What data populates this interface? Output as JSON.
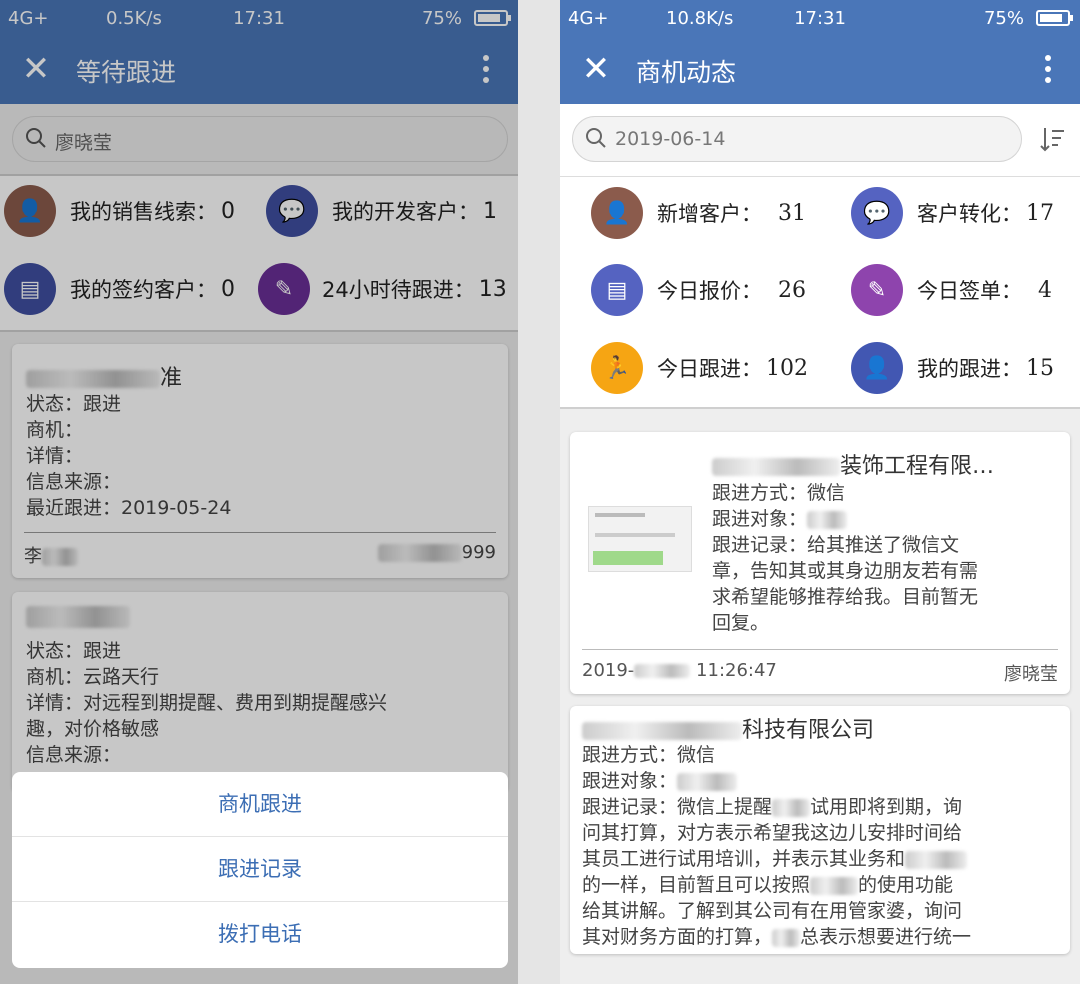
{
  "status_left": {
    "network": "4G+",
    "speed": "0.5K/s",
    "time": "17:31",
    "battery": "75%"
  },
  "status_right": {
    "network": "4G+",
    "speed": "10.8K/s",
    "time": "17:31",
    "battery": "75%"
  },
  "left": {
    "title": "等待跟进",
    "search_value": "廖晓莹",
    "stats": [
      {
        "label": "我的销售线索：",
        "value": "0",
        "icon": "user-icon",
        "color": "#8b5b4c"
      },
      {
        "label": "我的开发客户：",
        "value": "1",
        "icon": "chat-icon",
        "color": "#3f4fa0"
      },
      {
        "label": "我的签约客户：",
        "value": "0",
        "icon": "document-icon",
        "color": "#3f4fa0"
      },
      {
        "label": "24小时待跟进：",
        "value": "13",
        "icon": "edit-icon",
        "color": "#6a2f96"
      }
    ],
    "cards": [
      {
        "title_visible": "准",
        "lines": [
          "状态：跟进",
          "商机：",
          "详情：",
          "信息来源：",
          "最近跟进：2019-05-24"
        ],
        "footer_left": "李",
        "footer_right": "999"
      },
      {
        "lines": [
          "状态：跟进",
          "商机：云路天行",
          "详情：对远程到期提醒、费用到期提醒感兴",
          "趣，对价格敏感",
          "信息来源："
        ]
      }
    ],
    "sheet": [
      "商机跟进",
      "跟进记录",
      "拨打电话"
    ]
  },
  "right": {
    "title": "商机动态",
    "search_value": "2019-06-14",
    "stats": [
      {
        "label": "新增客户：",
        "value": "31",
        "icon": "user-icon",
        "color": "#8b5b4c"
      },
      {
        "label": "客户转化：",
        "value": "17",
        "icon": "chat-icon",
        "color": "#5563c1"
      },
      {
        "label": "今日报价：",
        "value": "26",
        "icon": "document-icon",
        "color": "#5563c1"
      },
      {
        "label": "今日签单：",
        "value": "4",
        "icon": "edit-icon",
        "color": "#8e44ad"
      },
      {
        "label": "今日跟进：",
        "value": "102",
        "icon": "runner-icon",
        "color": "#f6a513"
      },
      {
        "label": "我的跟进：",
        "value": "15",
        "icon": "person-icon",
        "color": "#4257b2"
      }
    ],
    "cards": [
      {
        "title": "装饰工程有限…",
        "method": "跟进方式：微信",
        "target": "跟进对象：",
        "record": [
          "跟进记录：给其推送了微信文",
          "章，告知其或其身边朋友若有需",
          "求希望能够推荐给我。目前暂无",
          "回复。"
        ],
        "date": "2019-",
        "time": "11:26:47",
        "author": "廖晓莹"
      },
      {
        "title": "科技有限公司",
        "method": "跟进方式：微信",
        "target": "跟进对象：",
        "record": [
          "跟进记录：微信上提醒",
          "试用即将到期，询",
          "问其打算，对方表示希望我这边儿安排时间给",
          "其员工进行试用培训，并表示其业务和",
          "的一样，目前暂且可以按照",
          "的使用功能",
          "给其讲解。了解到其公司有在用管家婆，询问",
          "其对财务方面的打算，",
          "总表示想要进行统一"
        ]
      }
    ]
  }
}
